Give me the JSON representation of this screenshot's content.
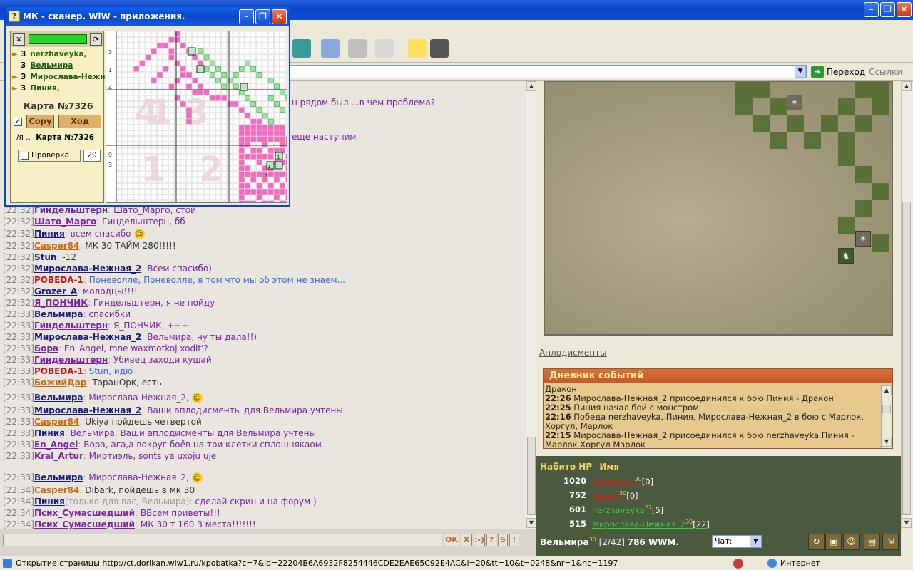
{
  "scanner": {
    "title": "МК - сканер. WiW - приложения.",
    "players": [
      {
        "num": "3",
        "name": "nerzhaveyka,",
        "color": "#2a6a10",
        "flag": true
      },
      {
        "num": "3",
        "name": "Вельмира",
        "color": "#1a5a10",
        "flag": false
      },
      {
        "num": "3",
        "name": "Мирослава-Нежная",
        "color": "#1a5a10",
        "flag": true
      },
      {
        "num": "3",
        "name": "Пиния,",
        "color": "#1a5a10",
        "flag": true
      }
    ],
    "card_title": "Карта №7326",
    "copy_label": "Copy",
    "move_label": "Ход",
    "sub_prefix": "/я ..",
    "sub_card": "Карта №7326",
    "verify_label": "Проверка",
    "verify_value": "20",
    "grid_row_labels": [
      "3",
      "1",
      "4",
      "9",
      "3"
    ],
    "grid_cell_labels": [
      "1",
      "1",
      "2"
    ]
  },
  "browser": {
    "go_label": "Переход",
    "links_label": "Ссылки"
  },
  "chat": {
    "partial_lines": [
      {
        "text": "н рядом был....в чем проблема?"
      },
      {
        "text": "еще наступим"
      }
    ],
    "lines": [
      {
        "time": "[22:32]",
        "nick": "Гиндельштерн",
        "nick_color": "#7b22a4",
        "sep": ": ",
        "msg": "Шато_Марго, стой",
        "msg_color": "#7b22a4"
      },
      {
        "time": "[22:32]",
        "nick": "Шато_Марго",
        "nick_color": "#7b22a4",
        "sep": ": ",
        "msg": "Гиндельштерн, бб",
        "msg_color": "#7b22a4"
      },
      {
        "time": "[22:32]",
        "nick": "Пиния",
        "nick_color": "#1a1a7a",
        "sep": ": ",
        "msg": "всем спасибо",
        "msg_color": "#7b22a4",
        "smile": true
      },
      {
        "time": "[22:32]",
        "nick": "Casper84",
        "nick_color": "#c86a12",
        "sep": ": ",
        "msg": "МК 30 ТАЙМ 280!!!!!",
        "msg_color": "#333333"
      },
      {
        "time": "[22:32]",
        "nick": "Stun",
        "nick_color": "#1a1a7a",
        "sep": ": ",
        "msg": "-12",
        "msg_color": "#333333"
      },
      {
        "time": "[22:32]",
        "nick": "Мирослава-Нежная_2",
        "nick_color": "#1a1a7a",
        "sep": ": ",
        "msg": "Всем спасибо)",
        "msg_color": "#7b22a4"
      },
      {
        "time": "[22:32]",
        "nick": "POBEDA-1",
        "nick_color": "#c81818",
        "sep": ": ",
        "msg": "Поневолле, Поневолле, в том что мы об этом не знаем...",
        "msg_color": "#3a6ad8"
      },
      {
        "time": "[22:32]",
        "nick": "Grozer_A",
        "nick_color": "#1a1a7a",
        "sep": ": ",
        "msg": "молодцы!!!!",
        "msg_color": "#7b22a4"
      },
      {
        "time": "[22:32]",
        "nick": "Я_ПОНЧИК",
        "nick_color": "#7b22a4",
        "sep": ": ",
        "msg": "Гиндельштерн, я не пойду",
        "msg_color": "#7b22a4"
      },
      {
        "time": "[22:33]",
        "nick": "Вельмира",
        "nick_color": "#1a1a7a",
        "sep": ": ",
        "msg": "спасибки",
        "msg_color": "#7b22a4"
      },
      {
        "time": "[22:33]",
        "nick": "Гиндельштерн",
        "nick_color": "#7b22a4",
        "sep": ": ",
        "msg": "Я_ПОНЧИК, +++",
        "msg_color": "#7b22a4"
      },
      {
        "time": "[22:33]",
        "nick": "Мирослава-Нежная_2",
        "nick_color": "#1a1a7a",
        "sep": ": ",
        "msg": "Вельмира, ну ты дала!!)",
        "msg_color": "#7b22a4"
      },
      {
        "time": "[22:33]",
        "nick": "Бора",
        "nick_color": "#7b22a4",
        "sep": ": ",
        "msg": "En_Angel, mne waxmotkoj xodit'?",
        "msg_color": "#7b22a4"
      },
      {
        "time": "[22:33]",
        "nick": "Гиндельштерн",
        "nick_color": "#7b22a4",
        "sep": ": ",
        "msg": "Убивец заходи кушай",
        "msg_color": "#7b22a4"
      },
      {
        "time": "[22:33]",
        "nick": "POBEDA-1",
        "nick_color": "#c81818",
        "sep": ": ",
        "msg": "Stun, идю",
        "msg_color": "#3a6ad8"
      },
      {
        "time": "[22:33]",
        "nick": "БожийДар",
        "nick_color": "#c86a12",
        "sep": ": ",
        "msg": "ТаранОрк, есть",
        "msg_color": "#333333"
      },
      {
        "time": "[22:33]",
        "nick": "Вельмира",
        "nick_color": "#1a1a7a",
        "sep": ": ",
        "msg": "Мирослава-Нежная_2,",
        "msg_color": "#7b22a4",
        "smile": true
      },
      {
        "time": "[22:33]",
        "nick": "Мирослава-Нежная_2",
        "nick_color": "#1a1a7a",
        "sep": ": ",
        "msg": "Ваши аплодисменты для Вельмира учтены",
        "msg_color": "#7b22a4"
      },
      {
        "time": "[22:33]",
        "nick": "Casper84",
        "nick_color": "#c86a12",
        "sep": ": ",
        "msg": "Ukiya пойдешь четвертой",
        "msg_color": "#333333"
      },
      {
        "time": "[22:33]",
        "nick": "Пиния",
        "nick_color": "#1a1a7a",
        "sep": ": ",
        "msg": "Вельмира, Ваши аплодисменты для Вельмира учтены",
        "msg_color": "#7b22a4"
      },
      {
        "time": "[22:33]",
        "nick": "En_Angel",
        "nick_color": "#7b22a4",
        "sep": ": ",
        "msg": "Бора, ага,а вокруг боёв на три клетки сплошнякаом",
        "msg_color": "#7b22a4"
      },
      {
        "time": "[22:33]",
        "nick": "Kral_Artur",
        "nick_color": "#7b22a4",
        "sep": ": ",
        "msg": "Миртиэль, sonts ya uxoju uje",
        "msg_color": "#7b22a4"
      },
      {
        "time": "[22:33]",
        "nick": "Вельмира",
        "nick_color": "#1a1a7a",
        "sep": ": ",
        "msg": "Мирослава-Нежная_2,",
        "msg_color": "#7b22a4",
        "smile": true
      },
      {
        "time": "[22:34]",
        "nick": "Casper84",
        "nick_color": "#c86a12",
        "sep": ": ",
        "msg": "Dibark, пойдешь в мк 30",
        "msg_color": "#333333"
      },
      {
        "time": "[22:34]",
        "nick": "Пиния",
        "nick_color": "#1a1a7a",
        "sep": "(только для вас, Вельмира): ",
        "msg": "сделай скрин и на форум )",
        "msg_color": "#7b22a4"
      },
      {
        "time": "[22:34]",
        "nick": "Псих_Сумасшедший",
        "nick_color": "#7b22a4",
        "sep": ": ",
        "msg": "ВВсем приветы!!!",
        "msg_color": "#7b22a4"
      },
      {
        "time": "[22:34]",
        "nick": "Псих_Сумасшедший",
        "nick_color": "#7b22a4",
        "sep": ": ",
        "msg": "МК 30 т 160 3 места!!!!!!!",
        "msg_color": "#7b22a4"
      }
    ],
    "buttons": [
      "OK",
      "X",
      ":-)",
      "?",
      "S",
      "!"
    ]
  },
  "right": {
    "applause_link": "Аплодисменты",
    "diary": {
      "title": "Дневник событий",
      "entries": [
        {
          "time": "",
          "text": "Дракон"
        },
        {
          "time": "22:26",
          "text": "Мирослава-Нежная_2 присоединился к бою Пиния - Дракон"
        },
        {
          "time": "22:25",
          "text": "Пиния начал бой с монстром"
        },
        {
          "time": "22:16",
          "text": "Победа nerzhaveyka, Пиния, Мирослава-Нежная_2 в бою с Марлок, Хоргул, Марлок"
        },
        {
          "time": "22:15",
          "text": "Мирослава-Нежная_2 присоединился к бою nerzhaveyka Пиния - Марлок Хоргул Марлок"
        }
      ]
    },
    "hp_table": {
      "col_hp": "Набито НР",
      "col_name": "Имя",
      "rows": [
        {
          "hp": "1020",
          "name": "Вельмира",
          "level": "30",
          "extra": "[0]",
          "color": "#d02020"
        },
        {
          "hp": "752",
          "name": "Пиния",
          "level": "30",
          "extra": "[0]",
          "color": "#d02020"
        },
        {
          "hp": "601",
          "name": "nerzhaveyka",
          "level": "27",
          "extra": "[5]",
          "color": "#3ad03a"
        },
        {
          "hp": "515",
          "name": "Мирослава-Нежная_2",
          "level": "30",
          "extra": "[22]",
          "color": "#3ad03a"
        }
      ]
    },
    "user": {
      "name": "Вельмира",
      "level": "30",
      "slots": "[2/42]",
      "money": "786 WWM."
    },
    "chat_select": "Чат:"
  },
  "statusbar": {
    "text": "Открытие страницы http://ct.dorikan.wiw1.ru/kpobatka?c=7&id=22204B6A6932F8254446CDE2EAE65C92E4AC&l=20&tt=10&t=0248&nr=1&nc=1197",
    "zone": "Интернет"
  }
}
